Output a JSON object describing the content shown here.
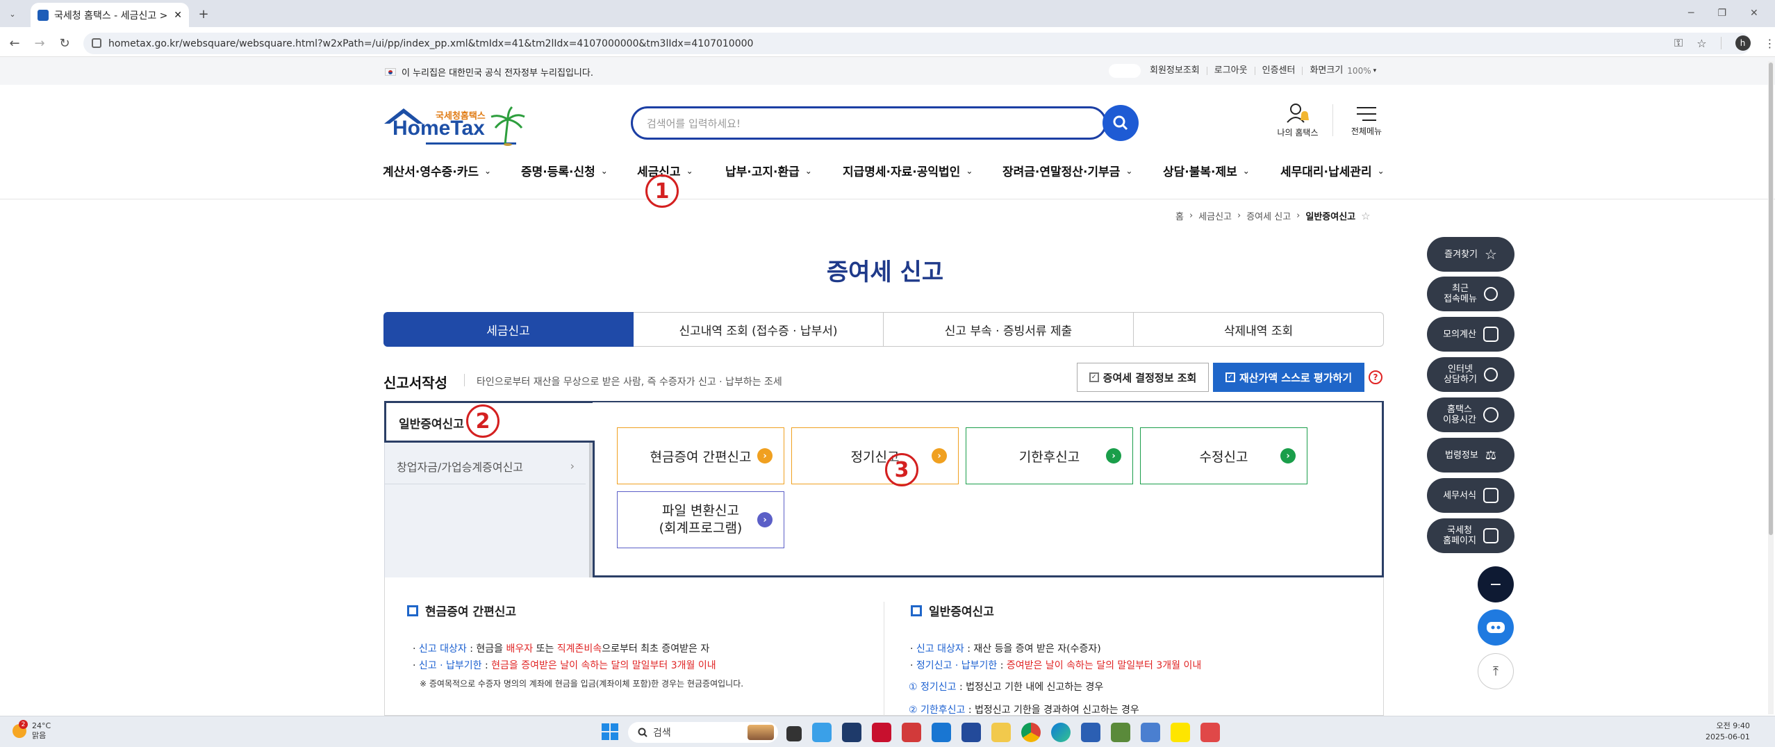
{
  "browser": {
    "tab_title": "국세청 홈택스 - 세금신고 > 증",
    "new_tab": "+",
    "url": "hometax.go.kr/websquare/websquare.html?w2xPath=/ui/pp/index_pp.xml&tmIdx=41&tm2lIdx=4107000000&tm3lIdx=4107010000",
    "profile_initial": "h"
  },
  "govbar": {
    "notice": "이 누리집은 대한민국 공식 전자정부 누리집입니다.",
    "links": [
      "회원정보조회",
      "로그아웃",
      "인증센터",
      "화면크기"
    ],
    "zoom": "100%"
  },
  "header": {
    "logo_small": "국세청홈택스",
    "logo_main": "HomeTax",
    "search_placeholder": "검색어를 입력하세요!",
    "my_hometax": "나의 홈택스",
    "all_menu": "전체메뉴"
  },
  "gnb": [
    "계산서·영수증·카드",
    "증명·등록·신청",
    "세금신고",
    "납부·고지·환급",
    "지급명세·자료·공익법인",
    "장려금·연말정산·기부금",
    "상담·불복·제보",
    "세무대리·납세관리"
  ],
  "breadcrumb": [
    "홈",
    "세금신고",
    "증여세 신고",
    "일반증여신고"
  ],
  "page_title": "증여세 신고",
  "tabs": [
    "세금신고",
    "신고내역 조회 (접수증 · 납부서)",
    "신고 부속 · 증빙서류 제출",
    "삭제내역 조회"
  ],
  "section": {
    "title": "신고서작성",
    "desc": "타인으로부터 재산을 무상으로 받은 사람, 즉 수증자가 신고 · 납부하는 조세",
    "btn_decision": "증여세 결정정보 조회",
    "btn_self_eval": "재산가액 스스로 평가하기",
    "help": "?"
  },
  "left_menu": [
    "일반증여신고",
    "창업자금/가업승계증여신고"
  ],
  "type_buttons": [
    {
      "label": "현금증여 간편신고",
      "color": "#f0a020"
    },
    {
      "label": "정기신고",
      "color": "#f0a020"
    },
    {
      "label": "기한후신고",
      "color": "#1a9e4a"
    },
    {
      "label": "수정신고",
      "color": "#1a9e4a"
    },
    {
      "label": "파일 변환신고",
      "label2": "(회계프로그램)",
      "color": "#5b5fc7"
    }
  ],
  "callouts": [
    "1",
    "2",
    "3"
  ],
  "info_left": {
    "heading": "현금증여 간편신고",
    "line1": {
      "label": "신고 대상자",
      "p1": " : 현금을 ",
      "h1": "배우자",
      "p2": " 또는 ",
      "h2": "직계존비속",
      "p3": "으로부터 최초 증여받은 자"
    },
    "line2": {
      "label": "신고 · 납부기한",
      "sep": " : ",
      "text": "현금을 증여받은 날이 속하는 달의 말일부터 3개월 이내"
    },
    "note": "※ 증여목적으로 수증자 명의의 계좌에 현금을 입금(계좌이체 포함)한 경우는 현금증여입니다."
  },
  "info_right": {
    "heading": "일반증여신고",
    "line1": {
      "label": "신고 대상자",
      "text": " : 재산 등을 증여 받은 자(수증자)"
    },
    "line2": {
      "label": "정기신고 · 납부기한",
      "sep": " : ",
      "text": "증여받은 날이 속하는 달의 말일부터 3개월 이내"
    },
    "line3": {
      "num": "①",
      "label": "정기신고",
      "text": " : 법정신고 기한 내에 신고하는 경우"
    },
    "line4": {
      "num": "②",
      "label": "기한후신고",
      "text": " : 법정신고 기한을 경과하여 신고하는 경우"
    }
  },
  "quick_menu": [
    "즐겨찾기",
    "최근\n접속메뉴",
    "모의계산",
    "인터넷\n상담하기",
    "홈택스\n이용시간",
    "법령정보",
    "세무서식",
    "국세청\n홈페이지"
  ],
  "quick_minus": "−",
  "taskbar": {
    "temp": "24°C",
    "weather": "맑음",
    "badge": "2",
    "search": "검색",
    "time": "오전 9:40",
    "date": "2025-06-01"
  }
}
